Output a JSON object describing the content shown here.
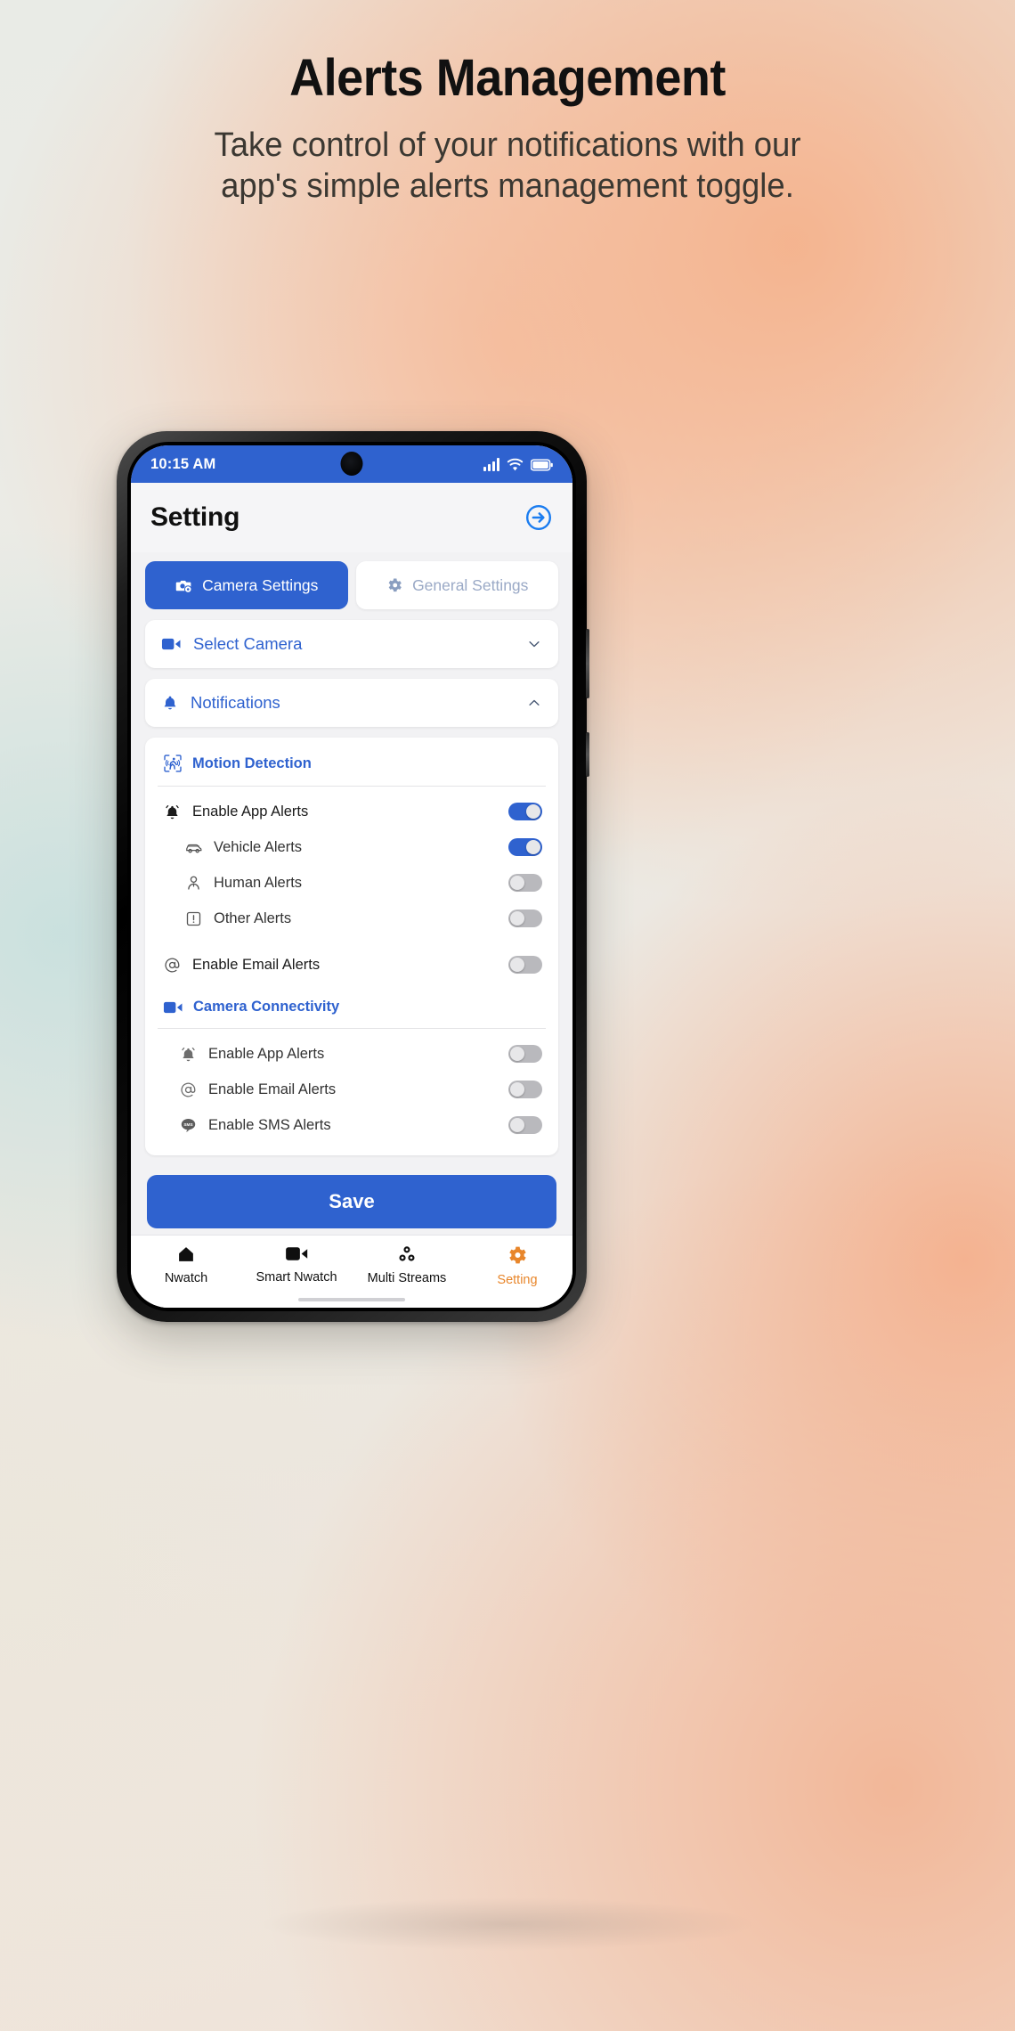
{
  "hero": {
    "title": "Alerts Management",
    "subtitle": "Take control of your notifications with our app's simple alerts management toggle."
  },
  "phone": {
    "status_bar": {
      "time": "10:15 AM",
      "icons": [
        "signal-icon",
        "wifi-icon",
        "battery-icon"
      ]
    },
    "app_bar": {
      "title": "Setting",
      "action_icon": "logout-icon"
    },
    "tabs": [
      {
        "label": "Camera Settings",
        "icon": "camera-settings-icon",
        "active": true
      },
      {
        "label": "General Settings",
        "icon": "gear-icon",
        "active": false
      }
    ],
    "accordions": [
      {
        "label": "Select Camera",
        "icon": "video-camera-icon",
        "chevron": "chevron-down-icon",
        "expanded": false
      },
      {
        "label": "Notifications",
        "icon": "bell-icon",
        "chevron": "chevron-up-icon",
        "expanded": true
      }
    ],
    "sections": [
      {
        "title": "Motion Detection",
        "icon": "motion-detection-icon",
        "rows": [
          {
            "label": "Enable App Alerts",
            "icon": "bell-filled-icon",
            "level": 0,
            "toggle": "on"
          },
          {
            "label": "Vehicle Alerts",
            "icon": "car-icon",
            "level": 1,
            "toggle": "on"
          },
          {
            "label": "Human Alerts",
            "icon": "person-icon",
            "level": 1,
            "toggle": "off"
          },
          {
            "label": "Other Alerts",
            "icon": "exclamation-square-icon",
            "level": 1,
            "toggle": "off"
          },
          {
            "label": "Enable Email Alerts",
            "icon": "at-icon",
            "level": 0,
            "toggle": "off"
          }
        ]
      },
      {
        "title": "Camera Connectivity",
        "icon": "video-camera-icon",
        "rows": [
          {
            "label": "Enable App Alerts",
            "icon": "bell-filled-icon",
            "level": 1,
            "toggle": "off"
          },
          {
            "label": "Enable Email Alerts",
            "icon": "at-icon",
            "level": 1,
            "toggle": "off"
          },
          {
            "label": "Enable SMS Alerts",
            "icon": "sms-icon",
            "level": 1,
            "toggle": "off"
          }
        ]
      }
    ],
    "save_label": "Save",
    "bottom_nav": [
      {
        "label": "Nwatch",
        "icon": "home-icon",
        "active": false
      },
      {
        "label": "Smart Nwatch",
        "icon": "video-camera-icon",
        "active": false
      },
      {
        "label": "Multi Streams",
        "icon": "multi-streams-icon",
        "active": false
      },
      {
        "label": "Setting",
        "icon": "gear-icon",
        "active": true
      }
    ]
  },
  "colors": {
    "primary_blue": "#2f62cf",
    "accent_orange": "#e8862b",
    "toggle_off": "#b9b9bd",
    "muted_tab_text": "#9aa9c6"
  }
}
